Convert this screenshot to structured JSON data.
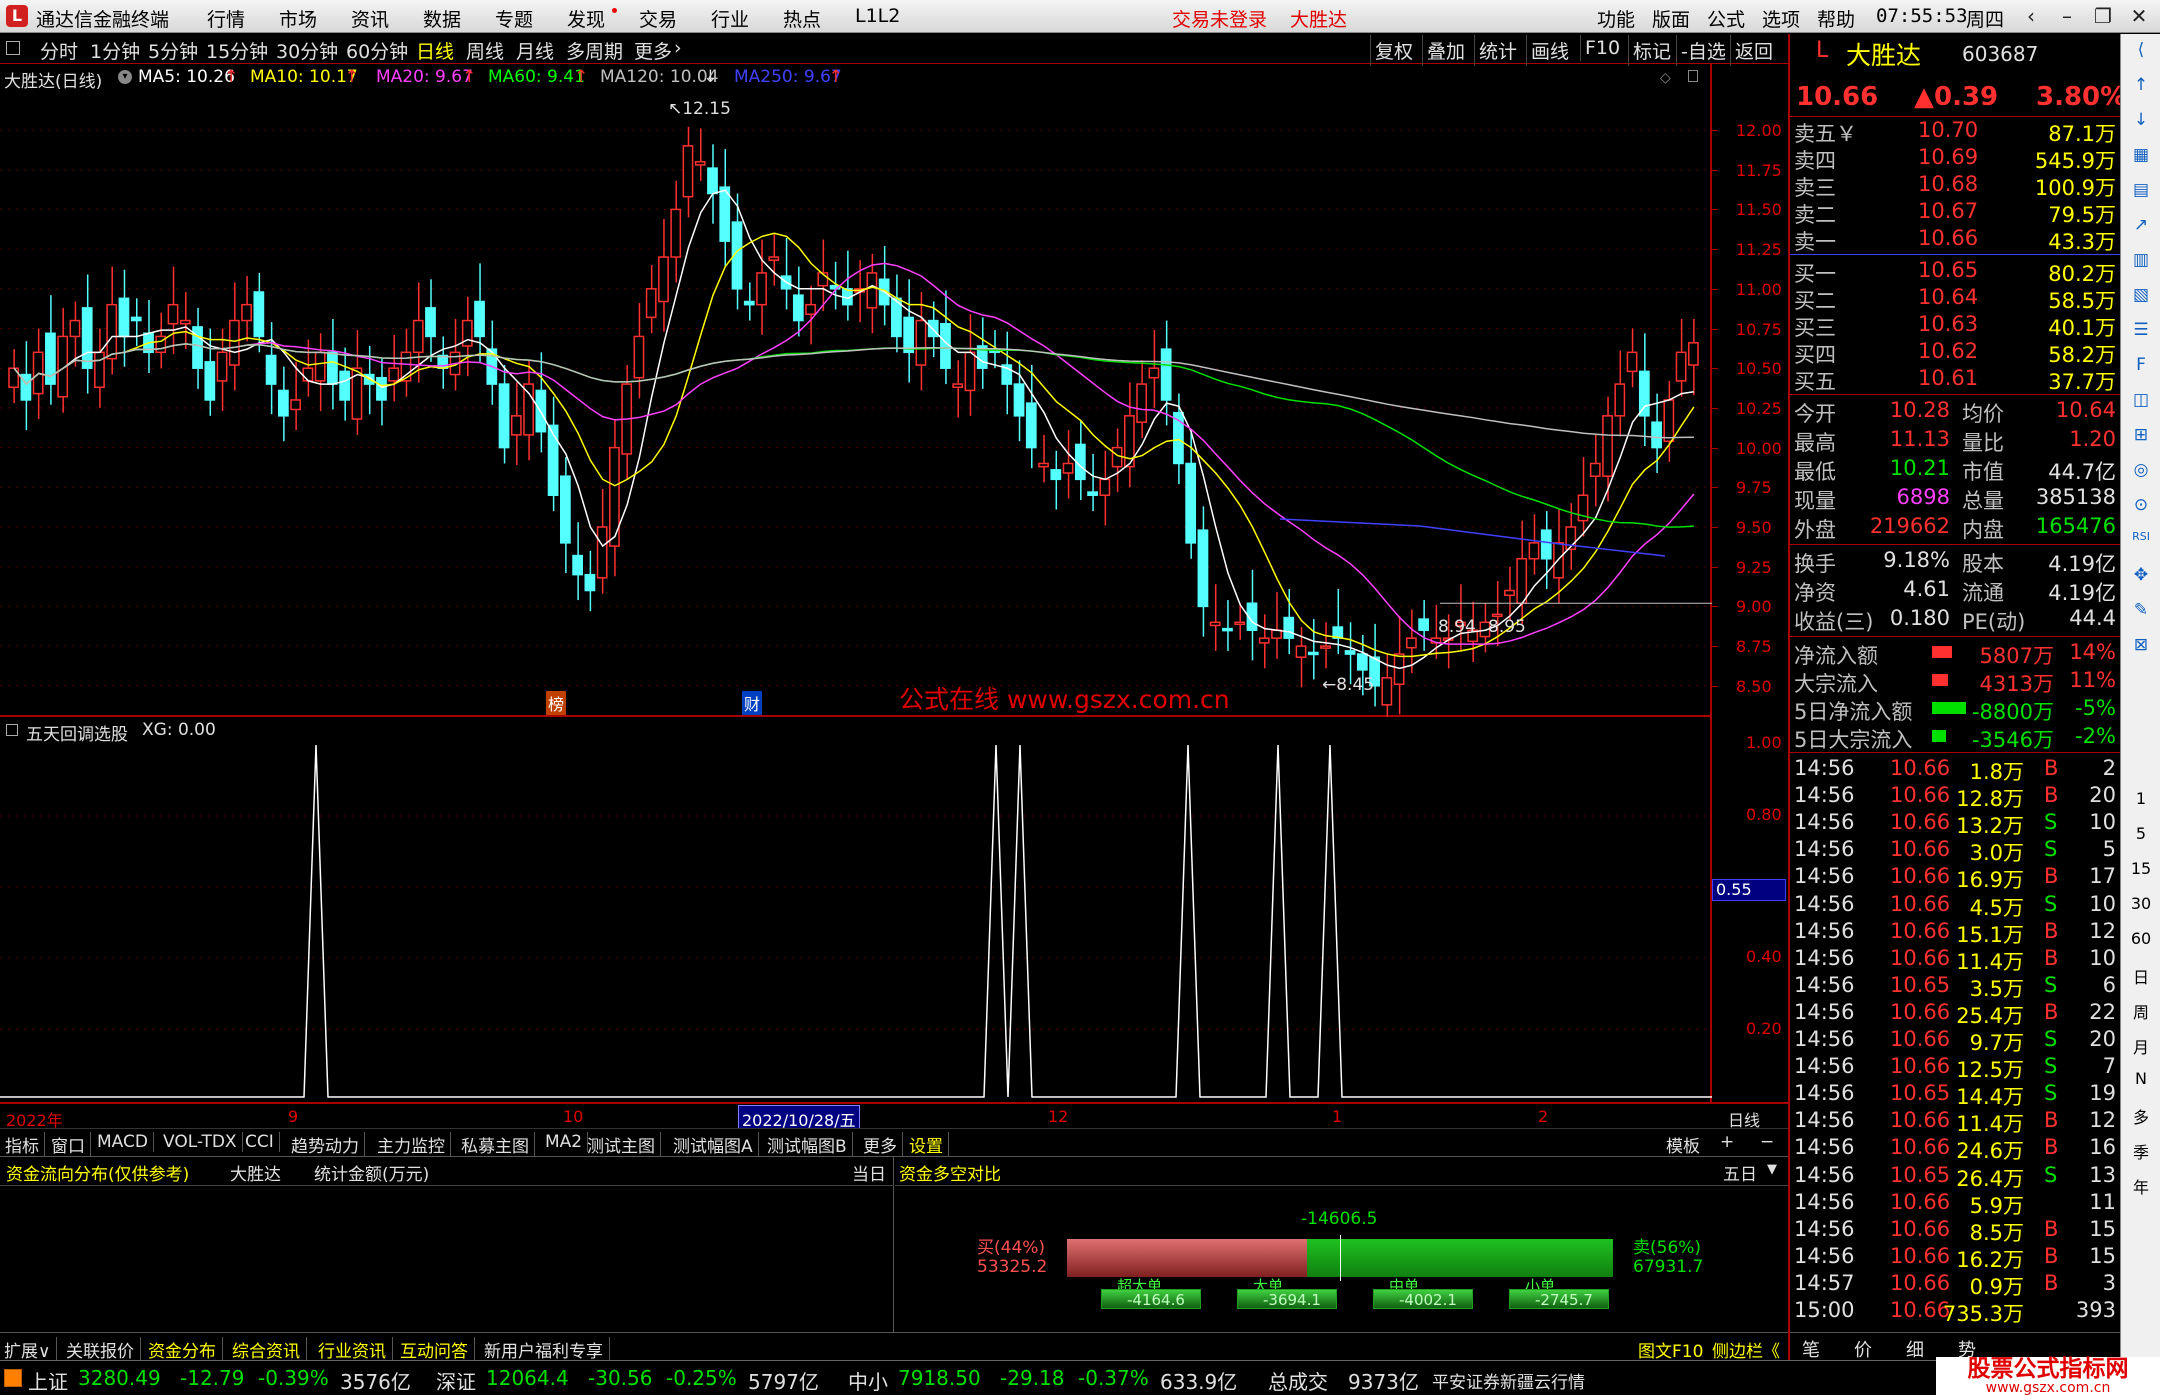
{
  "menubar": {
    "app_title": "通达信金融终端",
    "menus": [
      "行情",
      "市场",
      "资讯",
      "数据",
      "专题",
      "发现",
      "交易",
      "行业",
      "热点",
      "L1L2"
    ],
    "trade_status": "交易未登录",
    "stock_name": "大胜达",
    "right_menus": [
      "功能",
      "版面",
      "公式",
      "选项",
      "帮助"
    ],
    "time": "07:55:53",
    "weekday": "周四"
  },
  "toolbar": {
    "periods": [
      "分时",
      "1分钟",
      "5分钟",
      "15分钟",
      "30分钟",
      "60分钟",
      "日线",
      "周线",
      "月线",
      "多周期",
      "更多"
    ],
    "selected": "日线",
    "right_buttons": [
      "复权",
      "叠加",
      "统计",
      "画线",
      "F10",
      "标记",
      "-自选",
      "返回"
    ]
  },
  "main_chart": {
    "title": "大胜达(日线)",
    "ma_labels": [
      {
        "text": "MA5: 10.26",
        "color": "#ffffff"
      },
      {
        "text": "MA10: 10.17",
        "color": "#ffff00"
      },
      {
        "text": "MA20: 9.67",
        "color": "#ff40ff"
      },
      {
        "text": "MA60: 9.41",
        "color": "#00ff00"
      },
      {
        "text": "MA120: 10.04",
        "color": "#c0c0c0"
      },
      {
        "text": "MA250: 9.67",
        "color": "#4040ff"
      }
    ],
    "annotations": [
      "12.15",
      "8.45",
      "8.94",
      "8.95"
    ],
    "watermark": "公式在线  www.gszx.com.cn",
    "markers": [
      "榜",
      "财"
    ]
  },
  "price_axis": [
    "12.00",
    "11.75",
    "11.50",
    "11.25",
    "11.00",
    "10.75",
    "10.50",
    "10.25",
    "10.00",
    "9.75",
    "9.50",
    "9.25",
    "9.00",
    "8.75",
    "8.50"
  ],
  "sub_chart": {
    "title": "五天回调选股",
    "value_label": "XG: 0.00",
    "axis": [
      "1.00",
      "0.80",
      "0.55",
      "0.40",
      "0.20"
    ],
    "current": "0.55"
  },
  "date_axis": {
    "labels": [
      "2022年",
      "9",
      "10",
      "2022/10/28/五",
      "12",
      "1",
      "2"
    ],
    "period": "日线"
  },
  "indicator_tabs": [
    "指标",
    "窗口",
    "MACD",
    "VOL-TDX",
    "CCI",
    "趋势动力",
    "主力监控",
    "私募主图",
    "MA2",
    "测试主图",
    "测试幅图A",
    "测试幅图B",
    "更多",
    "设置"
  ],
  "indicator_right": [
    "模板",
    "+",
    "−"
  ],
  "fund_flow": {
    "title": "资金流向分布(仅供参考)",
    "stock": "大胜达",
    "unit": "统计金额(万元)",
    "period": "当日",
    "compare_title": "资金多空对比",
    "compare_period": "五日",
    "net": "-14606.5",
    "buy_label": "买(44%)",
    "buy_value": "53325.2",
    "sell_label": "卖(56%)",
    "sell_value": "67931.7",
    "buy_ratio": 0.44,
    "bars": [
      {
        "label": "超大单",
        "value": "-4164.6"
      },
      {
        "label": "大单",
        "value": "-3694.1"
      },
      {
        "label": "中单",
        "value": "-4002.1"
      },
      {
        "label": "小单",
        "value": "-2745.7"
      }
    ]
  },
  "bottom_tabs": [
    "扩展∨",
    "关联报价",
    "资金分布",
    "综合资讯",
    "行业资讯",
    "互动问答",
    "新用户福利专享"
  ],
  "bottom_right": [
    "图文F10",
    "侧边栏《"
  ],
  "quote": {
    "name": "大胜达",
    "code": "603687",
    "price": "10.66",
    "change": "▲0.39",
    "pct": "3.80%",
    "asks": [
      {
        "label": "卖五￥",
        "price": "10.70",
        "vol": "87.1万"
      },
      {
        "label": "卖四",
        "price": "10.69",
        "vol": "545.9万"
      },
      {
        "label": "卖三",
        "price": "10.68",
        "vol": "100.9万"
      },
      {
        "label": "卖二",
        "price": "10.67",
        "vol": "79.5万"
      },
      {
        "label": "卖一",
        "price": "10.66",
        "vol": "43.3万"
      }
    ],
    "bids": [
      {
        "label": "买一",
        "price": "10.65",
        "vol": "80.2万"
      },
      {
        "label": "买二",
        "price": "10.64",
        "vol": "58.5万"
      },
      {
        "label": "买三",
        "price": "10.63",
        "vol": "40.1万"
      },
      {
        "label": "买四",
        "price": "10.62",
        "vol": "58.2万"
      },
      {
        "label": "买五",
        "price": "10.61",
        "vol": "37.7万"
      }
    ],
    "stats": [
      {
        "l1": "今开",
        "v1": "10.28",
        "c1": "#ff3030",
        "l2": "均价",
        "v2": "10.64",
        "c2": "#ff3030"
      },
      {
        "l1": "最高",
        "v1": "11.13",
        "c1": "#ff3030",
        "l2": "量比",
        "v2": "1.20",
        "c2": "#ff3030"
      },
      {
        "l1": "最低",
        "v1": "10.21",
        "c1": "#00e000",
        "l2": "市值",
        "v2": "44.7亿",
        "c2": "#e0e0e0"
      },
      {
        "l1": "现量",
        "v1": "6898",
        "c1": "#ff40ff",
        "l2": "总量",
        "v2": "385138",
        "c2": "#e0e0e0"
      },
      {
        "l1": "外盘",
        "v1": "219662",
        "c1": "#ff3030",
        "l2": "内盘",
        "v2": "165476",
        "c2": "#00e000"
      }
    ],
    "stats2": [
      {
        "l1": "换手",
        "v1": "9.18%",
        "l2": "股本",
        "v2": "4.19亿"
      },
      {
        "l1": "净资",
        "v1": "4.61",
        "l2": "流通",
        "v2": "4.19亿"
      },
      {
        "l1": "收益(三)",
        "v1": "0.180",
        "l2": "PE(动)",
        "v2": "44.4"
      }
    ],
    "flows": [
      {
        "label": "净流入额",
        "value": "5807万",
        "pct": "14%",
        "color": "#ff3030",
        "bar": 0.5
      },
      {
        "label": "大宗流入",
        "value": "4313万",
        "pct": "11%",
        "color": "#ff3030",
        "bar": 0.4
      },
      {
        "label": "5日净流入额",
        "value": "-8800万",
        "pct": "-5%",
        "color": "#00e000",
        "bar": 0.85
      },
      {
        "label": "5日大宗流入",
        "value": "-3546万",
        "pct": "-2%",
        "color": "#00e000",
        "bar": 0.35
      }
    ],
    "ticks": [
      {
        "t": "14:56",
        "p": "10.66",
        "v": "1.8万",
        "bs": "B",
        "n": "2"
      },
      {
        "t": "14:56",
        "p": "10.66",
        "v": "12.8万",
        "bs": "B",
        "n": "20"
      },
      {
        "t": "14:56",
        "p": "10.66",
        "v": "13.2万",
        "bs": "S",
        "n": "10"
      },
      {
        "t": "14:56",
        "p": "10.66",
        "v": "3.0万",
        "bs": "S",
        "n": "5"
      },
      {
        "t": "14:56",
        "p": "10.66",
        "v": "16.9万",
        "bs": "B",
        "n": "17"
      },
      {
        "t": "14:56",
        "p": "10.66",
        "v": "4.5万",
        "bs": "S",
        "n": "10"
      },
      {
        "t": "14:56",
        "p": "10.66",
        "v": "15.1万",
        "bs": "B",
        "n": "12"
      },
      {
        "t": "14:56",
        "p": "10.66",
        "v": "11.4万",
        "bs": "B",
        "n": "10"
      },
      {
        "t": "14:56",
        "p": "10.65",
        "v": "3.5万",
        "bs": "S",
        "n": "6"
      },
      {
        "t": "14:56",
        "p": "10.66",
        "v": "25.4万",
        "bs": "B",
        "n": "22"
      },
      {
        "t": "14:56",
        "p": "10.66",
        "v": "9.7万",
        "bs": "S",
        "n": "20"
      },
      {
        "t": "14:56",
        "p": "10.66",
        "v": "12.5万",
        "bs": "S",
        "n": "7"
      },
      {
        "t": "14:56",
        "p": "10.65",
        "v": "14.4万",
        "bs": "S",
        "n": "19"
      },
      {
        "t": "14:56",
        "p": "10.66",
        "v": "11.4万",
        "bs": "B",
        "n": "12"
      },
      {
        "t": "14:56",
        "p": "10.66",
        "v": "24.6万",
        "bs": "B",
        "n": "16"
      },
      {
        "t": "14:56",
        "p": "10.65",
        "v": "26.4万",
        "bs": "S",
        "n": "13"
      },
      {
        "t": "14:56",
        "p": "10.66",
        "v": "5.9万",
        "bs": "",
        "n": "11"
      },
      {
        "t": "14:56",
        "p": "10.66",
        "v": "8.5万",
        "bs": "B",
        "n": "15"
      },
      {
        "t": "14:56",
        "p": "10.66",
        "v": "16.2万",
        "bs": "B",
        "n": "15"
      },
      {
        "t": "14:57",
        "p": "10.66",
        "v": "0.9万",
        "bs": "B",
        "n": "3"
      },
      {
        "t": "15:00",
        "p": "10.66",
        "v": "735.3万",
        "bs": "",
        "n": "393"
      }
    ],
    "bottom_tabs": [
      "笔",
      "价",
      "细",
      "势"
    ]
  },
  "side_labels": [
    "1",
    "5",
    "15",
    "30",
    "60",
    "日",
    "周",
    "月",
    "N",
    "多",
    "季",
    "年"
  ],
  "statusbar": {
    "items": [
      {
        "name": "上证",
        "val": "3280.49",
        "chg": "-12.79",
        "pct": "-0.39%",
        "amt": "3576亿"
      },
      {
        "name": "深证",
        "val": "12064.4",
        "chg": "-30.56",
        "pct": "-0.25%",
        "amt": "5797亿"
      },
      {
        "name": "中小",
        "val": "7918.50",
        "chg": "-29.18",
        "pct": "-0.37%",
        "amt": "633.9亿"
      }
    ],
    "total_label": "总成交",
    "total": "9373亿",
    "broker": "平安证券新疆云行情",
    "brand": "股票公式指标网",
    "brand_url": "www.gszx.com.cn"
  }
}
